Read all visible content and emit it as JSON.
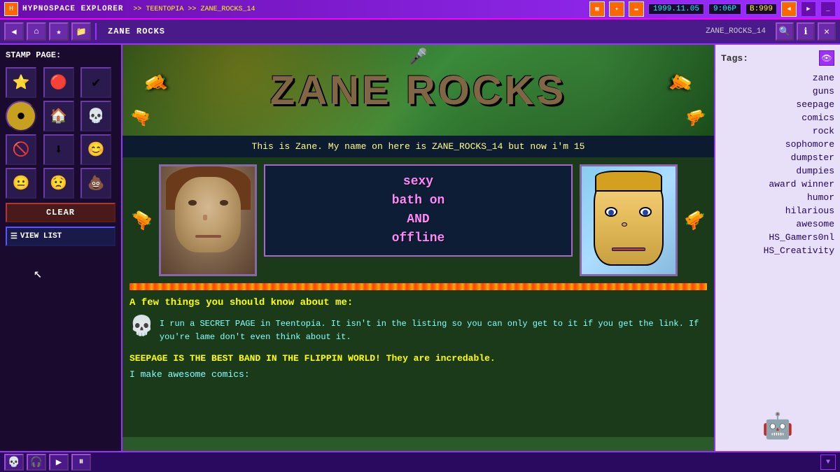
{
  "titleBar": {
    "appTitle": "HYPNOSPACE EXPLORER",
    "navPath": ">> TEENTOPIA >> ZANE_ROCKS_14",
    "date": "1999.11.05",
    "time": "9:06P",
    "credits": "B:999"
  },
  "navBar": {
    "pageTitle": "ZANE ROCKS",
    "pageId": "ZANE_ROCKS_14"
  },
  "stampPanel": {
    "label": "STAMP PAGE:",
    "stamps": [
      "⭐",
      "🎯",
      "✔",
      "🟡",
      "🏠",
      "💀",
      "🚫",
      "⬇",
      "😊",
      "😐",
      "😟",
      "💩"
    ],
    "clearLabel": "CLEAR",
    "viewListLabel": "VIEW LIST"
  },
  "pageContent": {
    "headerTitle": "ZANE ROCKS",
    "introText": "This is Zane. My name on here is ZANE_ROCKS_14 but now i'm 15",
    "sexyText": "sexy\nbath on\nAND\noffline",
    "aboutHeader": "A few things you should know about me:",
    "secretText": "I run a SECRET PAGE in Teentopia. It isn't in the listing so you can only get to it if you get the link. If you're lame don't even think about it.",
    "bandText": "SEEPAGE IS THE BEST BAND IN THE FLIPPIN WORLD! They are incredable.",
    "comicsText": "I make awesome comics:"
  },
  "tags": {
    "label": "Tags:",
    "items": [
      "zane",
      "guns",
      "seepage",
      "comics",
      "rock",
      "sophomore",
      "dumpster",
      "dumpies",
      "award winner",
      "humor",
      "hilarious",
      "awesome",
      "HS_Gamers0nl",
      "HS_Creativity"
    ]
  },
  "bottomBar": {
    "skullBtn": "💀",
    "headphonesBtn": "🎧",
    "playBtn": "▶",
    "pauseBtn": "⏸"
  }
}
